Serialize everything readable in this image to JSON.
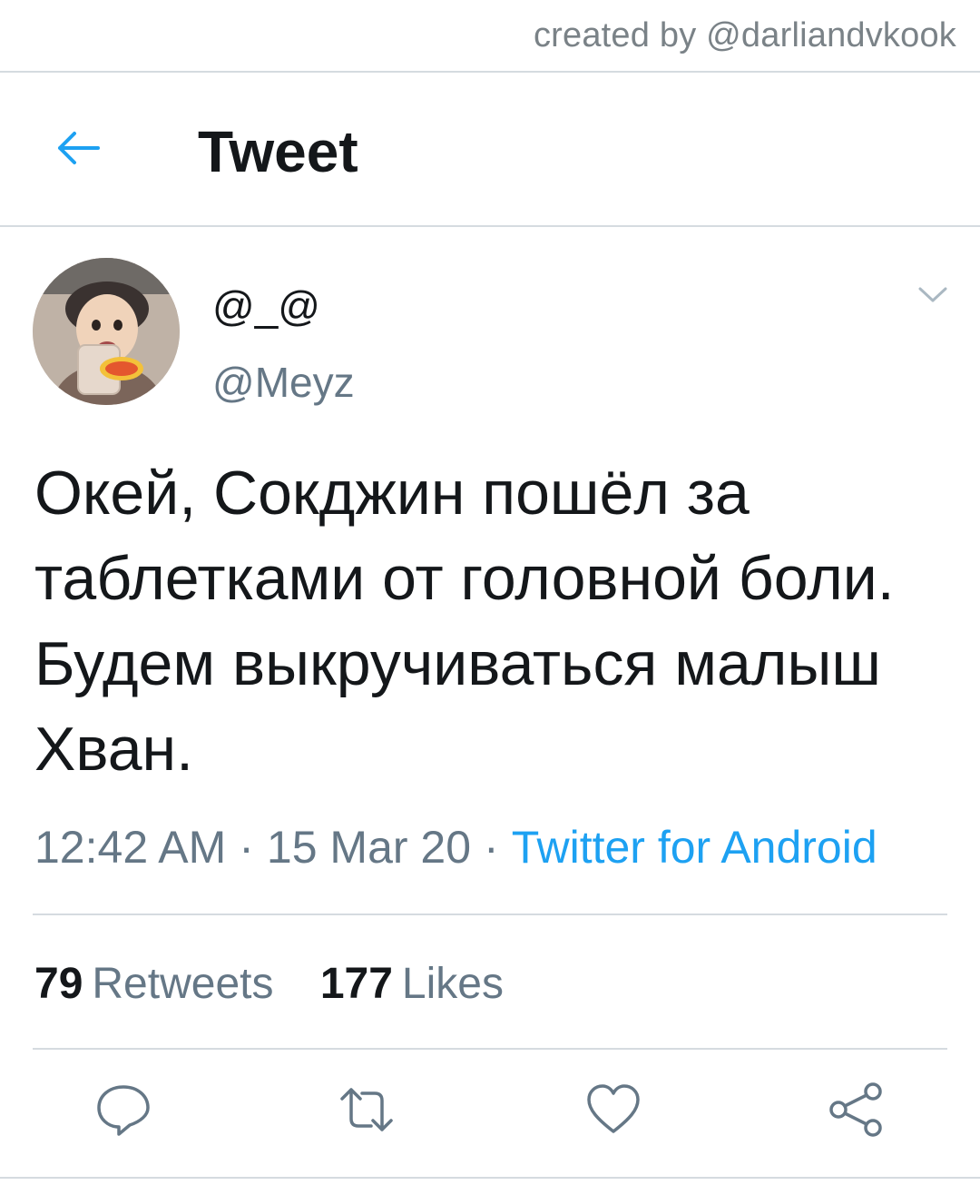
{
  "watermark": "created by @darliandvkook",
  "header": {
    "title": "Tweet",
    "back_icon": "arrow-left-icon"
  },
  "tweet": {
    "author": {
      "display_name": "@_@",
      "handle": "@Meyz"
    },
    "text": "Окей, Сокджин пошёл за таблетками от головной боли. Будем выкручиваться малыш Хван.",
    "time": "12:42 AM",
    "date": "15 Mar 20",
    "separator": "·",
    "source": "Twitter for Android",
    "stats": {
      "retweets_count": "79",
      "retweets_label": "Retweets",
      "likes_count": "177",
      "likes_label": "Likes"
    },
    "actions": [
      "reply-icon",
      "retweet-icon",
      "like-icon",
      "share-icon"
    ]
  },
  "colors": {
    "accent": "#1da1f2",
    "secondary_text": "#657786",
    "primary_text": "#14171a",
    "divider": "#d5dbe0"
  }
}
